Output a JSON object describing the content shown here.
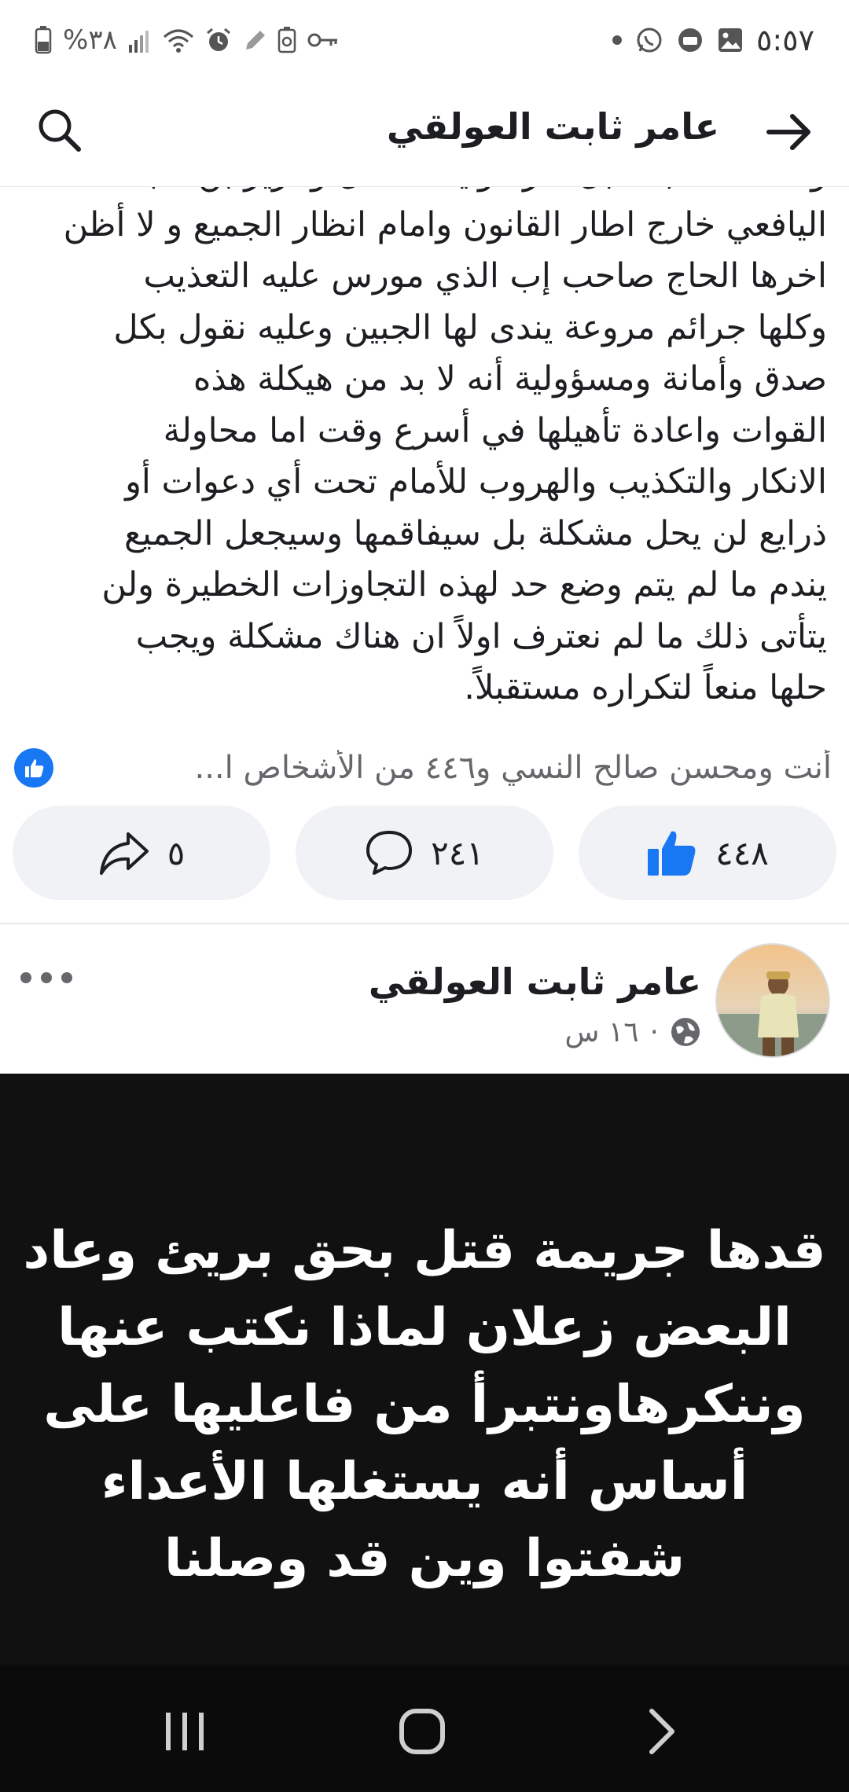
{
  "status_bar": {
    "time": "٥:٥٧",
    "battery": "%٣٨",
    "icons_right": [
      "dot-icon",
      "whatsapp-icon",
      "app-icon",
      "gallery-icon"
    ],
    "icons_left": [
      "battery-icon",
      "signal-icon",
      "wifi-icon",
      "alarm-icon",
      "pen-icon",
      "battery-saver-icon",
      "key-icon"
    ]
  },
  "header": {
    "title": "عامر ثابت العولقي"
  },
  "post": {
    "body": "واحدث صنجه قبل فترة وايضا مقتل وعزيز بن شبعه\nاليافعي خارج اطار القانون وامام انظار الجميع و لا أظن\nاخرها الحاج صاحب إب الذي مورس عليه التعذيب\nوكلها جرائم مروعة يندى لها الجبين وعليه نقول بكل\nصدق وأمانة ومسؤولية أنه لا بد من هيكلة هذه\nالقوات واعادة تأهيلها في أسرع وقت اما محاولة\nالانكار والتكذيب والهروب للأمام تحت أي دعوات أو\nذرايع لن يحل مشكلة بل سيفاقمها وسيجعل الجميع\nيندم ما لم يتم وضع حد لهذه التجاوزات الخطيرة ولن\nيتأتى ذلك ما لم نعترف اولاً ان هناك مشكلة ويجب\nحلها منعاً لتكراره مستقبلاً.",
    "reactions_text": "أنت ومحسن صالح النسي و٤٤٦ من الأشخاص ا...",
    "likes": "٤٤٨",
    "comments": "٢٤١",
    "shares": "٥"
  },
  "post2": {
    "author": "عامر ثابت العولقي",
    "time": "١٦ س",
    "separator": "·",
    "image_text": "قدها جريمة قتل بحق بريئ وعاد\nالبعض زعلان لماذا نكتب عنها\nوننكرهاونتبرأ من فاعليها على\nأساس أنه يستغلها الأعداء\nشفتوا وين قد وصلنا"
  },
  "colors": {
    "brand": "#1877f2",
    "pill_bg": "#f0f2f5",
    "secondary_text": "#65676b"
  }
}
